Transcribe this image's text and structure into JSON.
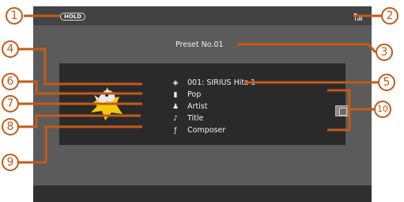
{
  "status_bar": {
    "hold_label": "HOLD",
    "signal_icon": "signal-strength-icon"
  },
  "preset_label": "Preset No.01",
  "info": {
    "channel": "001: SIRIUS Hits 1",
    "category": "Pop",
    "artist": "Artist",
    "title": "Title",
    "composer": "Composer"
  },
  "row_icons": {
    "channel": "dog-icon",
    "category": "folder-icon",
    "artist": "person-icon",
    "title": "music-note-icon",
    "composer": "composer-icon"
  },
  "callouts": [
    "1",
    "2",
    "3",
    "4",
    "5",
    "6",
    "7",
    "8",
    "9",
    "10"
  ],
  "colors": {
    "screen": "#5b5b5b",
    "panel": "#2a2a2a",
    "callout": "#c45a18",
    "logo_yellow": "#f2c80f"
  }
}
